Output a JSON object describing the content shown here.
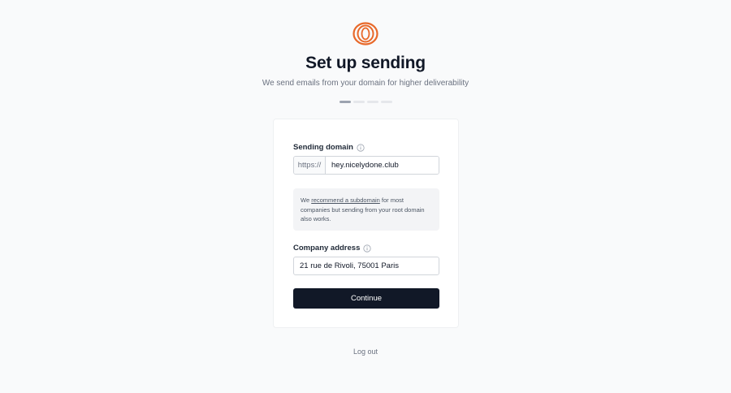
{
  "header": {
    "logo_icon": "orange-rings-logo",
    "title": "Set up sending",
    "subtitle": "We send emails from your domain for higher deliverability",
    "steps_total": 4,
    "steps_active": 1
  },
  "form": {
    "domain_label": "Sending domain",
    "domain_prefix": "https://",
    "domain_value": "hey.nicelydone.club",
    "note_before": "We ",
    "note_link": "recommend a subdomain",
    "note_after": " for most companies but sending from your root domain also works.",
    "address_label": "Company address",
    "address_value": "21 rue de Rivoli, 75001 Paris",
    "continue_label": "Continue"
  },
  "footer": {
    "logout_label": "Log out"
  },
  "colors": {
    "accent": "#e8692a",
    "button": "#111827"
  }
}
